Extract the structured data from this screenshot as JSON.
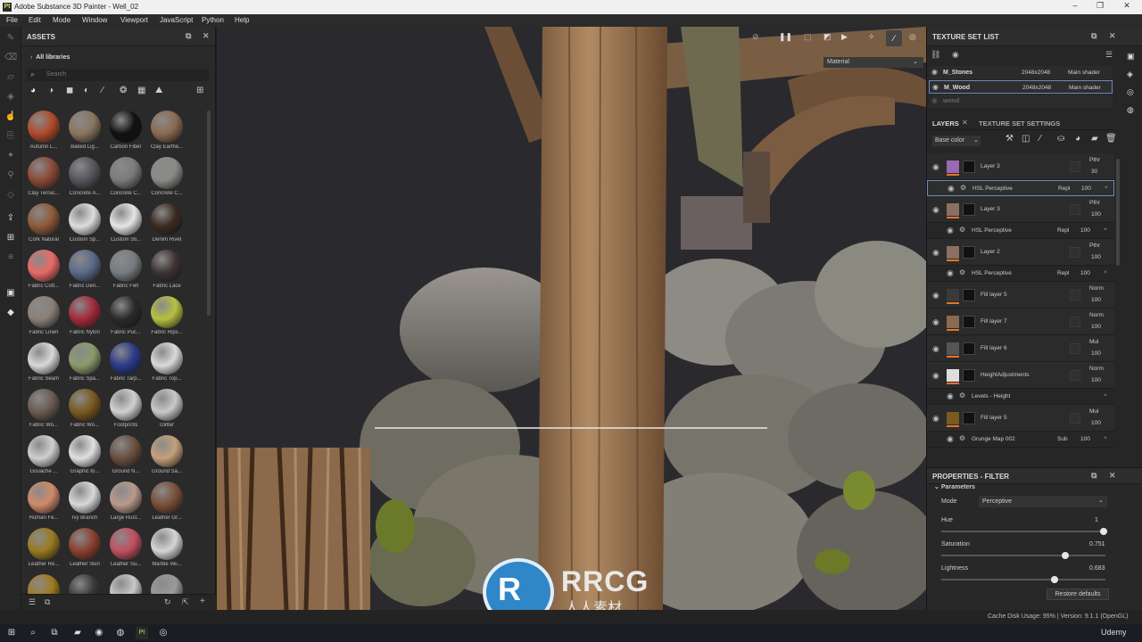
{
  "window": {
    "title": "Adobe Substance 3D Painter - Well_02",
    "app_icon": "Pt"
  },
  "menu": [
    "File",
    "Edit",
    "Mode",
    "Window",
    "Viewport",
    "JavaScript",
    "Python",
    "Help"
  ],
  "assets": {
    "title": "ASSETS",
    "breadcrumb": "All libraries",
    "search_placeholder": "Search",
    "items": [
      {
        "label": "Autumn L...",
        "color": "#b04a2a"
      },
      {
        "label": "Baked Lig...",
        "color": "#8a7560"
      },
      {
        "label": "Carbon Fiber",
        "color": "#111111"
      },
      {
        "label": "Clay Earthe...",
        "color": "#8c6a52"
      },
      {
        "label": "Clay Terrac...",
        "color": "#8b4a36"
      },
      {
        "label": "Concrete A...",
        "color": "#55555c"
      },
      {
        "label": "Concrete C...",
        "color": "#7b7b7b"
      },
      {
        "label": "Concrete C...",
        "color": "#8a8a85"
      },
      {
        "label": "Cork Natural",
        "color": "#8c5a38"
      },
      {
        "label": "Custom Sp...",
        "color": "#dddddd"
      },
      {
        "label": "Custom Sti...",
        "color": "#e5e5e5"
      },
      {
        "label": "Denim Rivet",
        "color": "#3a2a20"
      },
      {
        "label": "Fabric Cott...",
        "color": "#e86a66"
      },
      {
        "label": "Fabric Den...",
        "color": "#5a6a8a"
      },
      {
        "label": "Fabric Felt",
        "color": "#777c82"
      },
      {
        "label": "Fabric Lace",
        "color": "#3e3232"
      },
      {
        "label": "Fabric Linen",
        "color": "#8a8078"
      },
      {
        "label": "Fabric Nylon",
        "color": "#a22a3a"
      },
      {
        "label": "Fabric Puc...",
        "color": "#2a2a2a"
      },
      {
        "label": "Fabric Rips...",
        "color": "#b7c040"
      },
      {
        "label": "Fabric Seam",
        "color": "#d8d8d8"
      },
      {
        "label": "Fabric Spa...",
        "color": "#8a9a6a"
      },
      {
        "label": "Fabric Tarp...",
        "color": "#2a3a8a"
      },
      {
        "label": "Fabric Top...",
        "color": "#dadada"
      },
      {
        "label": "Fabric Wo...",
        "color": "#6a5a52"
      },
      {
        "label": "Fabric Wo...",
        "color": "#7a5a20"
      },
      {
        "label": "Footprints",
        "color": "#d0d0d0"
      },
      {
        "label": "Glitter",
        "color": "#c8c8c8"
      },
      {
        "label": "Gouache ...",
        "color": "#cfcfcf"
      },
      {
        "label": "Graphic to...",
        "color": "#e0e0e0"
      },
      {
        "label": "Ground N...",
        "color": "#6a5040"
      },
      {
        "label": "Ground Sa...",
        "color": "#c4a07a"
      },
      {
        "label": "Human Fe...",
        "color": "#d08a6a"
      },
      {
        "label": "Ivy Branch",
        "color": "#d8d8d8"
      },
      {
        "label": "Large Rust...",
        "color": "#b89a8a"
      },
      {
        "label": "Leather Gr...",
        "color": "#7a5038"
      },
      {
        "label": "Leather Re...",
        "color": "#9a7a20"
      },
      {
        "label": "Leather Skin",
        "color": "#8a4030"
      },
      {
        "label": "Leather Su...",
        "color": "#c05060"
      },
      {
        "label": "Marble Vei...",
        "color": "#d5d5d5"
      },
      {
        "label": "",
        "color": "#a07a20"
      },
      {
        "label": "",
        "color": "#3a3a3a"
      },
      {
        "label": "",
        "color": "#c8c8c8"
      },
      {
        "label": "",
        "color": "#9a9a9a"
      }
    ]
  },
  "viewport": {
    "material_mode": "Material"
  },
  "texture_set_list": {
    "title": "TEXTURE SET LIST",
    "sets": [
      {
        "name": "M_Stones",
        "res": "2048x2048",
        "shader": "Main shader"
      },
      {
        "name": "M_Wood",
        "res": "2048x2048",
        "shader": "Main shader"
      },
      {
        "name": "wood",
        "res": "",
        "shader": ""
      }
    ]
  },
  "layers_panel": {
    "tab_layers": "LAYERS",
    "tab_settings": "TEXTURE SET SETTINGS",
    "channel": "Base color",
    "rows": [
      {
        "kind": "layer",
        "name": "Layer 3",
        "blend": "Pthr",
        "opacity": "30",
        "swatch": "#9a6ab0"
      },
      {
        "kind": "sub",
        "name": "HSL Perceptive",
        "blend": "Repl",
        "opacity": "100"
      },
      {
        "kind": "layer",
        "name": "Layer 3",
        "blend": "Pthr",
        "opacity": "100",
        "swatch": "#8a7060"
      },
      {
        "kind": "sub",
        "name": "HSL Perceptive",
        "blend": "Repl",
        "opacity": "100"
      },
      {
        "kind": "layer",
        "name": "Layer 2",
        "blend": "Pthr",
        "opacity": "100",
        "swatch": "#8a7060"
      },
      {
        "kind": "sub",
        "name": "HSL Perceptive",
        "blend": "Repl",
        "opacity": "100"
      },
      {
        "kind": "layer",
        "name": "Fill layer 5",
        "blend": "Norm",
        "opacity": "100",
        "swatch": "#3a3a3a"
      },
      {
        "kind": "layer",
        "name": "Fill layer 7",
        "blend": "Norm",
        "opacity": "100",
        "swatch": "#8a6a50"
      },
      {
        "kind": "layer",
        "name": "Fill layer 6",
        "blend": "Mul",
        "opacity": "100",
        "swatch": "#555555"
      },
      {
        "kind": "layer",
        "name": "HeightAdjustments",
        "blend": "Norm",
        "opacity": "100",
        "swatch": "#dddddd"
      },
      {
        "kind": "sub",
        "name": "Levels - Height",
        "blend": "",
        "opacity": ""
      },
      {
        "kind": "layer",
        "name": "Fill layer 5",
        "blend": "Mul",
        "opacity": "100",
        "swatch": "#7a5a20"
      },
      {
        "kind": "sub",
        "name": "Grunge Map 002",
        "blend": "Sub",
        "opacity": "100"
      }
    ]
  },
  "properties": {
    "title": "PROPERTIES - FILTER",
    "section": "Parameters",
    "mode_label": "Mode",
    "mode_value": "Perceptive",
    "hue_label": "Hue",
    "hue_value": "1",
    "sat_label": "Saturation",
    "sat_value": "0.751",
    "light_label": "Lightness",
    "light_value": "0.683",
    "restore": "Restore defaults"
  },
  "status": {
    "text": "Cache Disk Usage:  95% | Version: 9.1.1 (OpenGL)"
  },
  "watermark": {
    "logo": "RRCG",
    "sub": "人人素材",
    "udemy": "Udemy"
  }
}
